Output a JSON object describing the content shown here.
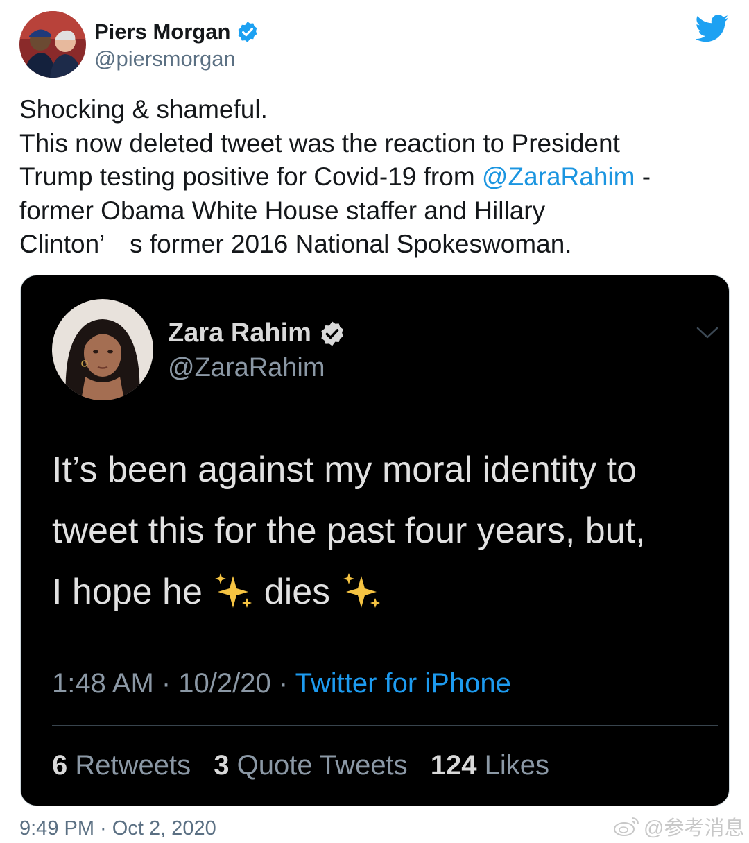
{
  "tweet": {
    "author": {
      "name": "Piers Morgan",
      "handle": "@piersmorgan",
      "verified": true
    },
    "text_lines": [
      "Shocking & shameful.",
      "This now deleted tweet was the reaction to President",
      "Trump testing positive for Covid-19 from ",
      "@ZaraRahim",
      " -",
      "former Obama White House staffer and Hillary",
      "Clinton’　s former 2016 National Spokeswoman."
    ],
    "timestamp": "9:49 PM · Oct 2, 2020",
    "icons": {
      "avatar": "avatar-photo",
      "verified": "verified-badge-icon",
      "logo": "twitter-bird-icon"
    }
  },
  "embedded_tweet": {
    "author": {
      "name": "Zara Rahim",
      "handle": "@ZaraRahim",
      "verified": true
    },
    "text_lines": [
      "It’s been against my moral identity to",
      "tweet this for the past four years, but,",
      "I hope he",
      "dies"
    ],
    "time": "1:48 AM · 10/2/20 · ",
    "source": "Twitter for iPhone",
    "stats": {
      "retweets_count": "6",
      "retweets_label": " Retweets",
      "quotes_count": "3",
      "quotes_label": " Quote Tweets",
      "likes_count": "124",
      "likes_label": " Likes"
    },
    "icons": {
      "sparkle": "sparkles-emoji-icon",
      "menu": "chevron-down-icon"
    }
  },
  "watermark": {
    "text": "@参考消息",
    "icon": "weibo-logo-icon"
  },
  "colors": {
    "twitter_blue": "#1da1f2",
    "link_blue": "#1b95e0",
    "embed_background": "#000000"
  }
}
